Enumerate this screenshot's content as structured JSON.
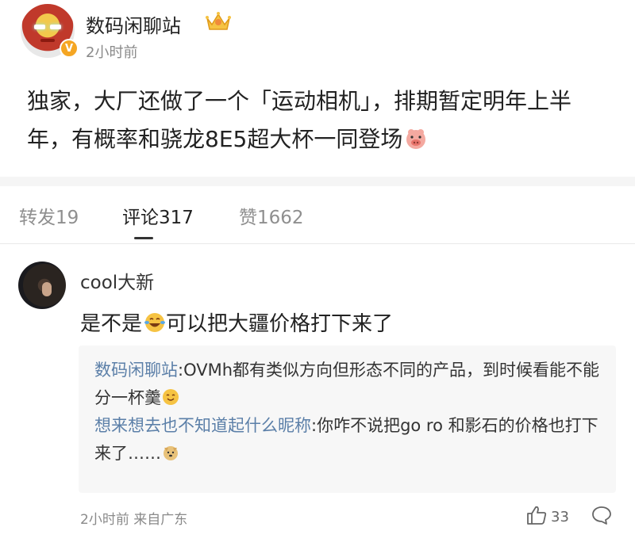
{
  "post": {
    "author": "数码闲聊站",
    "time": "2小时前",
    "verified_badge": "V",
    "body_text": "独家，大厂还做了一个「运动相机」，排期暂定明年上半年，有概率和骁龙8E5超大杯一同登场",
    "body_emoji": "pig-face-emoji",
    "accent_color": "#f5a623"
  },
  "tabs": [
    {
      "label": "转发19",
      "active": false
    },
    {
      "label": "评论317",
      "active": true
    },
    {
      "label": "赞1662",
      "active": false
    }
  ],
  "comment": {
    "user": "cool大新",
    "text_before_emoji": "是不是",
    "emoji": "laughing-tears-emoji",
    "text_after_emoji": "可以把大疆价格打下来了",
    "replies": [
      {
        "user": "数码闲聊站",
        "text": ":OVMh都有类似方向但形态不同的产品，到时候看能不能分一杯羹",
        "emoji": "smile-emoji"
      },
      {
        "user": "想来想去也不知道起什么昵称",
        "text": ":你咋不说把go ro 和影石的价格也打下来了……",
        "emoji": "doge-emoji"
      }
    ],
    "meta": "2小时前 来自广东",
    "like_count": "33",
    "link_color": "#5b7fa8"
  }
}
